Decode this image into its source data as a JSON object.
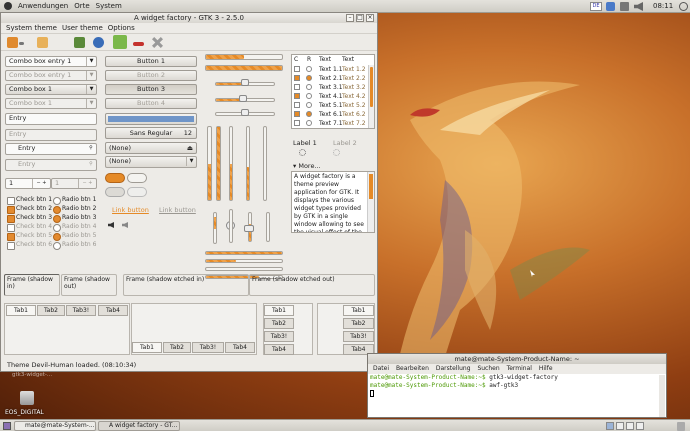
{
  "top_panel": {
    "applications": "Anwendungen",
    "places": "Orte",
    "system": "System",
    "lang": "DE",
    "clock": "08:11"
  },
  "window": {
    "title": "A widget factory - GTK 3 - 2.5.0",
    "menu": [
      "System theme",
      "User theme",
      "Options"
    ],
    "combos": [
      "Combo box entry 1",
      "Combo box entry 1",
      "Combo box 1",
      "Combo box 1"
    ],
    "entries": [
      "Entry",
      "Entry",
      "Entry",
      "Entry"
    ],
    "spin1": "1",
    "spin2": "1",
    "checks": [
      "Check btn 1",
      "Check btn 2",
      "Check btn 3",
      "Check btn 4",
      "Check btn 5",
      "Check btn 6"
    ],
    "radios": [
      "Radio btn 1",
      "Radio btn 2",
      "Radio btn 3",
      "Radio btn 4",
      "Radio btn 5",
      "Radio btn 6"
    ],
    "buttons": [
      "Button 1",
      "Button 2",
      "Button 3",
      "Button 4"
    ],
    "font_button": "Sans Regular",
    "font_size": "12",
    "none1": "(None)",
    "none2": "(None)",
    "link1": "Link button",
    "link2": "Link button",
    "table_headers": [
      "C",
      "R",
      "Text",
      "Text"
    ],
    "table_rows": [
      [
        "Text 1.1",
        "Text 1.2"
      ],
      [
        "Text 2.1",
        "Text 2.2"
      ],
      [
        "Text 3.1",
        "Text 3.2"
      ],
      [
        "Text 4.1",
        "Text 4.2"
      ],
      [
        "Text 5.1",
        "Text 5.2"
      ],
      [
        "Text 6.1",
        "Text 6.2"
      ],
      [
        "Text 7.1",
        "Text 7.2"
      ]
    ],
    "label1": "Label 1",
    "label2": "Label 2",
    "more": "More...",
    "textview": "A widget factory is a theme preview application for GTK. It displays the various widget types provided by GTK in a single window allowing to see the visual effect of the applied",
    "frames": [
      "Frame (shadow in)",
      "Frame (shadow out)",
      "Frame (shadow etched in)",
      "Frame (shadow etched out)"
    ],
    "tabs_top": [
      "Tab1",
      "Tab2",
      "Tab3!",
      "Tab4"
    ],
    "tabs_bottom": [
      "Tab1",
      "Tab2",
      "Tab3!",
      "Tab4"
    ],
    "tabs_left": [
      "Tab1",
      "Tab2",
      "Tab3!",
      "Tab4"
    ],
    "tabs_right": [
      "Tab1",
      "Tab2",
      "Tab3!",
      "Tab4"
    ],
    "status": "Theme Devil-Human loaded.  (08:10:34)"
  },
  "desktop": {
    "icon_label": "EOS_DIGITAL",
    "hidden_label": "gtk3-widget-..."
  },
  "terminal": {
    "title": "mate@mate-System-Product-Name: ~",
    "menu": [
      "Datei",
      "Bearbeiten",
      "Darstellung",
      "Suchen",
      "Terminal",
      "Hilfe"
    ],
    "prompt": "mate@mate-System-Product-Name:~$",
    "cmd1": "gtk3-widget-factory",
    "cmd2": "awf-gtk3"
  },
  "taskbar": {
    "task1": "mate@mate-System-...",
    "task2": "A widget factory - GT..."
  },
  "colors": {
    "accent": "#e58a27",
    "terminal_prompt": "#4e9a06"
  }
}
